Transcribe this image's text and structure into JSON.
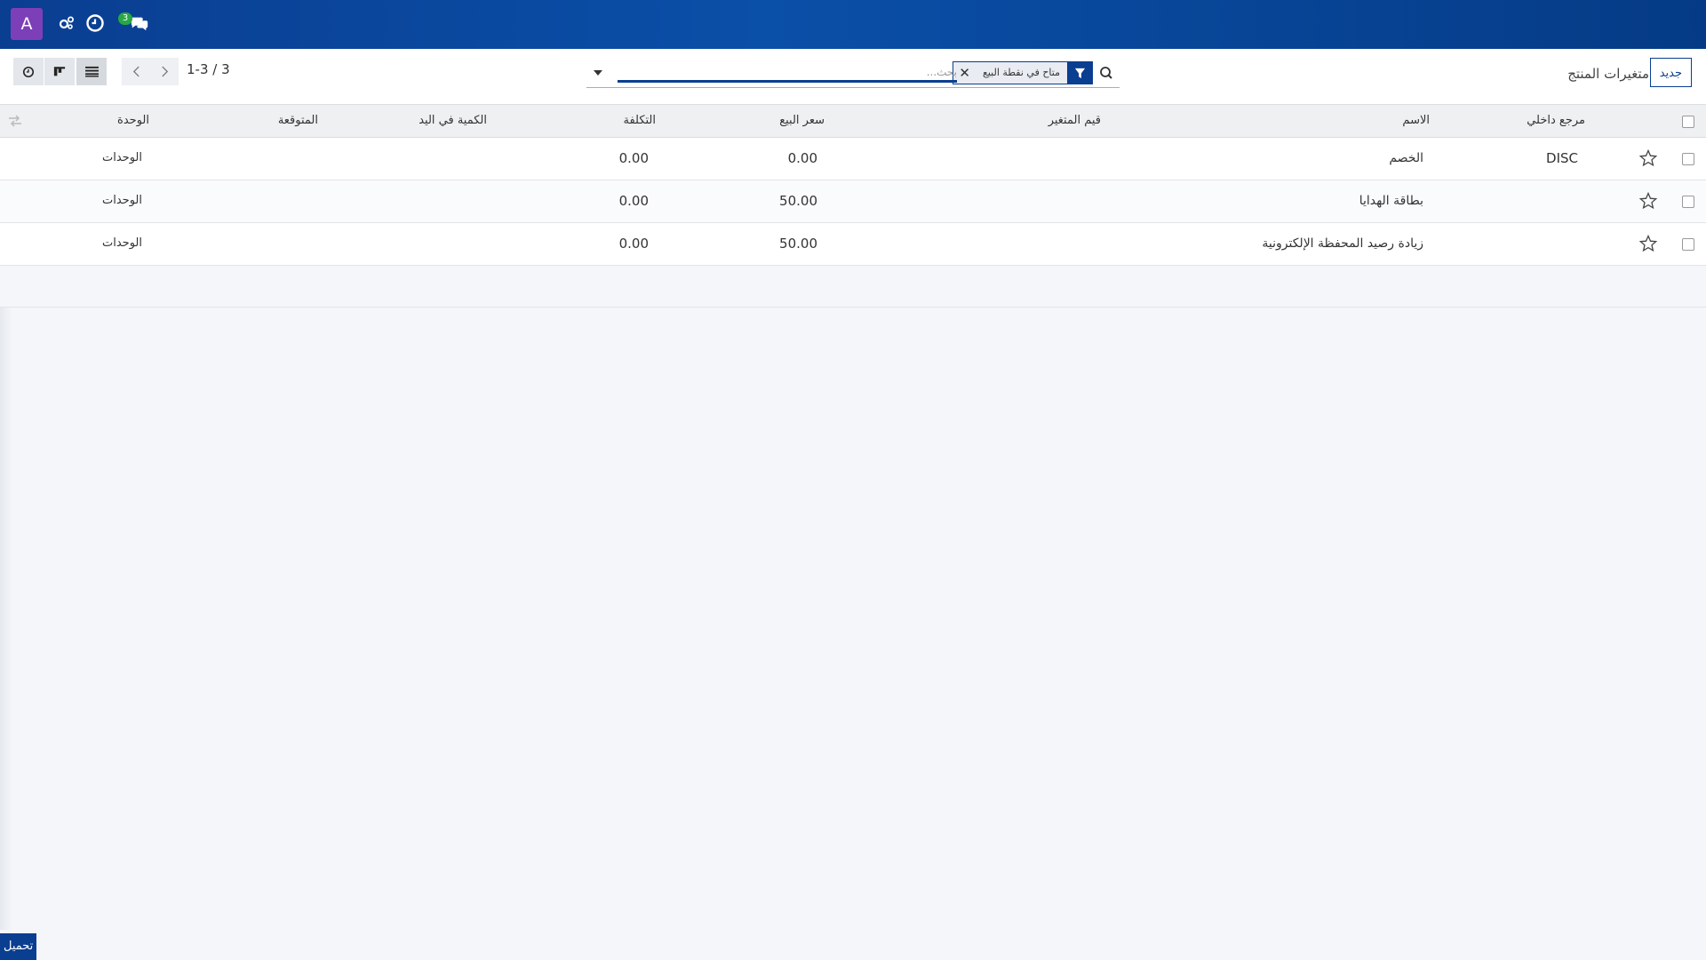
{
  "navbar": {
    "avatar_letter": "A",
    "messages_count": "3",
    "icons": [
      "chat-icon",
      "clock-icon",
      "settings-gear-icon"
    ]
  },
  "control_panel": {
    "title": "متغيرات المنتج",
    "new_button": "جديد",
    "search": {
      "facet_label": "متاح في نقطة البيع",
      "placeholder": "بحث..."
    },
    "pager": "1-3 / 3"
  },
  "table": {
    "headers": {
      "internal_ref": "مرجع داخلي",
      "name": "الاسم",
      "variant_values": "قيم المتغير",
      "sale_price": "سعر البيع",
      "cost": "التكلفة",
      "qty_on_hand": "الكمية في اليد",
      "forecasted": "المتوقعة",
      "uom": "الوحدة"
    },
    "rows": [
      {
        "internal_ref": "DISC",
        "name": "الخصم",
        "sale_price": "0.00",
        "cost": "0.00",
        "uom": "الوحدات"
      },
      {
        "internal_ref": "",
        "name": "بطاقة الهدايا",
        "sale_price": "50.00",
        "cost": "0.00",
        "uom": "الوحدات"
      },
      {
        "internal_ref": "",
        "name": "زيادة رصيد المحفظة الإلكترونية",
        "sale_price": "50.00",
        "cost": "0.00",
        "uom": "الوحدات"
      }
    ]
  },
  "footer": {
    "download_label": "تحميل"
  },
  "colors": {
    "primary": "#0a3e91",
    "avatar": "#7c3fb8",
    "badge": "#28a745"
  }
}
